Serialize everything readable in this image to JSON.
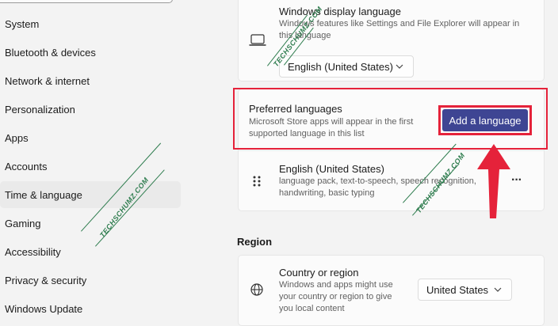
{
  "sidebar": {
    "items": [
      {
        "label": "System"
      },
      {
        "label": "Bluetooth & devices"
      },
      {
        "label": "Network & internet"
      },
      {
        "label": "Personalization"
      },
      {
        "label": "Apps"
      },
      {
        "label": "Accounts"
      },
      {
        "label": "Time & language",
        "active": true
      },
      {
        "label": "Gaming"
      },
      {
        "label": "Accessibility"
      },
      {
        "label": "Privacy & security"
      },
      {
        "label": "Windows Update"
      }
    ]
  },
  "display_language": {
    "title": "Windows display language",
    "description_line1": "Windows features like Settings and File Explorer will appear in",
    "description_line2": "this language",
    "selected": "English (United States)",
    "icon": "laptop-icon"
  },
  "preferred_languages": {
    "title": "Preferred languages",
    "description_line1": "Microsoft Store apps will appear in the first",
    "description_line2": "supported language in this list",
    "add_button_label": "Add a language",
    "languages": [
      {
        "name": "English (United States)",
        "detail_line1": "language pack, text-to-speech, speech recognition,",
        "detail_line2": "handwriting, basic typing",
        "more_label": "···"
      }
    ]
  },
  "region": {
    "section_label": "Region",
    "country_title": "Country or region",
    "country_desc_line1": "Windows and apps might use",
    "country_desc_line2": "your country or region to give",
    "country_desc_line3": "you local content",
    "country_selected": "United States",
    "icon": "globe-icon"
  },
  "watermark": "TECHSCHUMZ.COM",
  "colors": {
    "accent_button": "#3e4593",
    "highlight_red": "#e5223a",
    "watermark_green": "#2f7d4f"
  }
}
